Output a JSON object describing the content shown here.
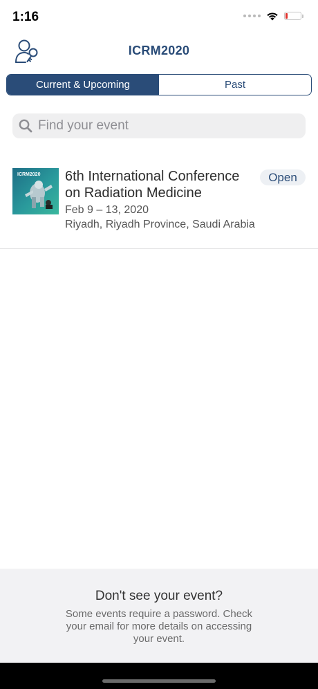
{
  "status_bar": {
    "time": "1:16",
    "icons": [
      "signal-dots-icon",
      "wifi-icon",
      "battery-low-icon"
    ],
    "battery_color": "#e0332d"
  },
  "nav": {
    "title": "ICRM2020",
    "left_icon": "account-key-icon"
  },
  "segments": [
    {
      "label": "Current & Upcoming",
      "selected": true
    },
    {
      "label": "Past",
      "selected": false
    }
  ],
  "search": {
    "placeholder": "Find your event",
    "value": "",
    "icon": "search-icon"
  },
  "events": [
    {
      "thumbnail_text": "ICRM2020",
      "title": "6th International Conference on Radiation Medicine",
      "date": "Feb 9 – 13, 2020",
      "location": "Riyadh, Riyadh Province, Saudi Arabia",
      "status": "Open"
    }
  ],
  "footer": {
    "title": "Don't see your event?",
    "text": "Some events require a password. Check your email for more details on accessing your event."
  },
  "colors": {
    "accent": "#2a4c78",
    "background": "#ffffff",
    "search_background": "#efeff0",
    "footer_background": "#f2f2f4"
  }
}
